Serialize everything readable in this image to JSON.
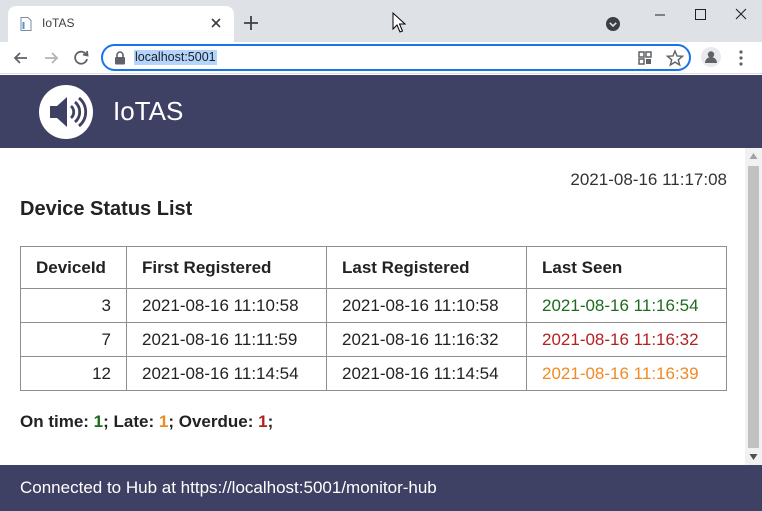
{
  "browser": {
    "tab_title": "IoTAS",
    "url": "localhost:5001"
  },
  "app": {
    "title": "IoTAS",
    "logo_icon": "speaker-icon"
  },
  "page": {
    "timestamp": "2021-08-16 11:17:08",
    "title": "Device Status List"
  },
  "table": {
    "headers": [
      "DeviceId",
      "First Registered",
      "Last Registered",
      "Last Seen"
    ],
    "rows": [
      {
        "device_id": "3",
        "first_registered": "2021-08-16 11:10:58",
        "last_registered": "2021-08-16 11:10:58",
        "last_seen": "2021-08-16 11:16:54",
        "status": "on-time"
      },
      {
        "device_id": "7",
        "first_registered": "2021-08-16 11:11:59",
        "last_registered": "2021-08-16 11:16:32",
        "last_seen": "2021-08-16 11:16:32",
        "status": "overdue"
      },
      {
        "device_id": "12",
        "first_registered": "2021-08-16 11:14:54",
        "last_registered": "2021-08-16 11:14:54",
        "last_seen": "2021-08-16 11:16:39",
        "status": "late"
      }
    ]
  },
  "summary": {
    "on_time_label": "On time: ",
    "on_time_count": "1",
    "late_label": "; Late: ",
    "late_count": "1",
    "overdue_label": "; Overdue: ",
    "overdue_count": "1",
    "trailing": ";"
  },
  "footer": {
    "text": "Connected to Hub at https://localhost:5001/monitor-hub"
  },
  "colors": {
    "header_bg": "#3f4164",
    "on_time": "#1e6b1e",
    "late": "#f08a24",
    "overdue": "#b22222",
    "omnibox_focus": "#1a73e8"
  }
}
